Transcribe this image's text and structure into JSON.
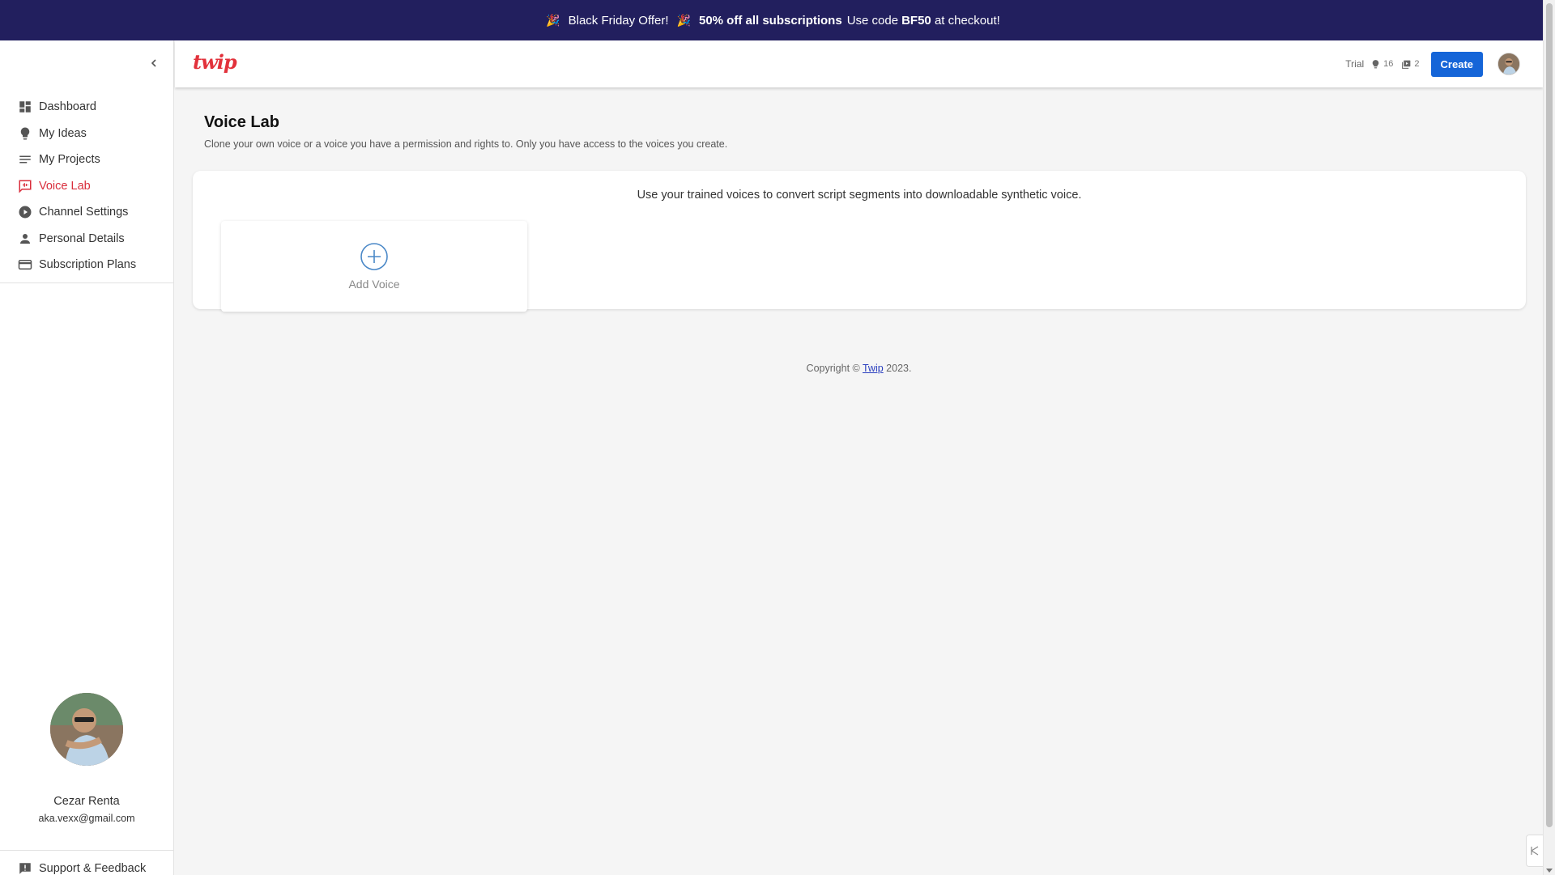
{
  "banner": {
    "offer": "Black Friday Offer!",
    "discount": "50% off all subscriptions",
    "code_prefix": "Use code",
    "code": "BF50",
    "code_suffix": "at checkout!"
  },
  "sidebar": {
    "items": [
      {
        "label": "Dashboard",
        "icon": "dashboard-icon"
      },
      {
        "label": "My Ideas",
        "icon": "lightbulb-icon"
      },
      {
        "label": "My Projects",
        "icon": "list-icon"
      },
      {
        "label": "Voice Lab",
        "icon": "voice-lab-icon",
        "active": true
      },
      {
        "label": "Channel Settings",
        "icon": "play-circle-icon"
      },
      {
        "label": "Personal Details",
        "icon": "person-icon"
      },
      {
        "label": "Subscription Plans",
        "icon": "credit-card-icon"
      }
    ],
    "user": {
      "name": "Cezar Renta",
      "email": "aka.vexx@gmail.com"
    },
    "support_label": "Support & Feedback"
  },
  "header": {
    "logo": "twip",
    "trial": "Trial",
    "ideas_count": "16",
    "projects_count": "2",
    "create_label": "Create"
  },
  "main": {
    "title": "Voice Lab",
    "subtitle": "Clone your own voice or a voice you have a permission and rights to. Only you have access to the voices you create.",
    "card_text": "Use your trained voices to convert script segments into downloadable synthetic voice.",
    "add_voice_label": "Add Voice"
  },
  "footer": {
    "prefix": "Copyright ©",
    "link": "Twip",
    "suffix": "2023."
  },
  "colors": {
    "banner_bg": "#221f5e",
    "accent_red": "#d92d3b",
    "primary_blue": "#1565d8"
  }
}
